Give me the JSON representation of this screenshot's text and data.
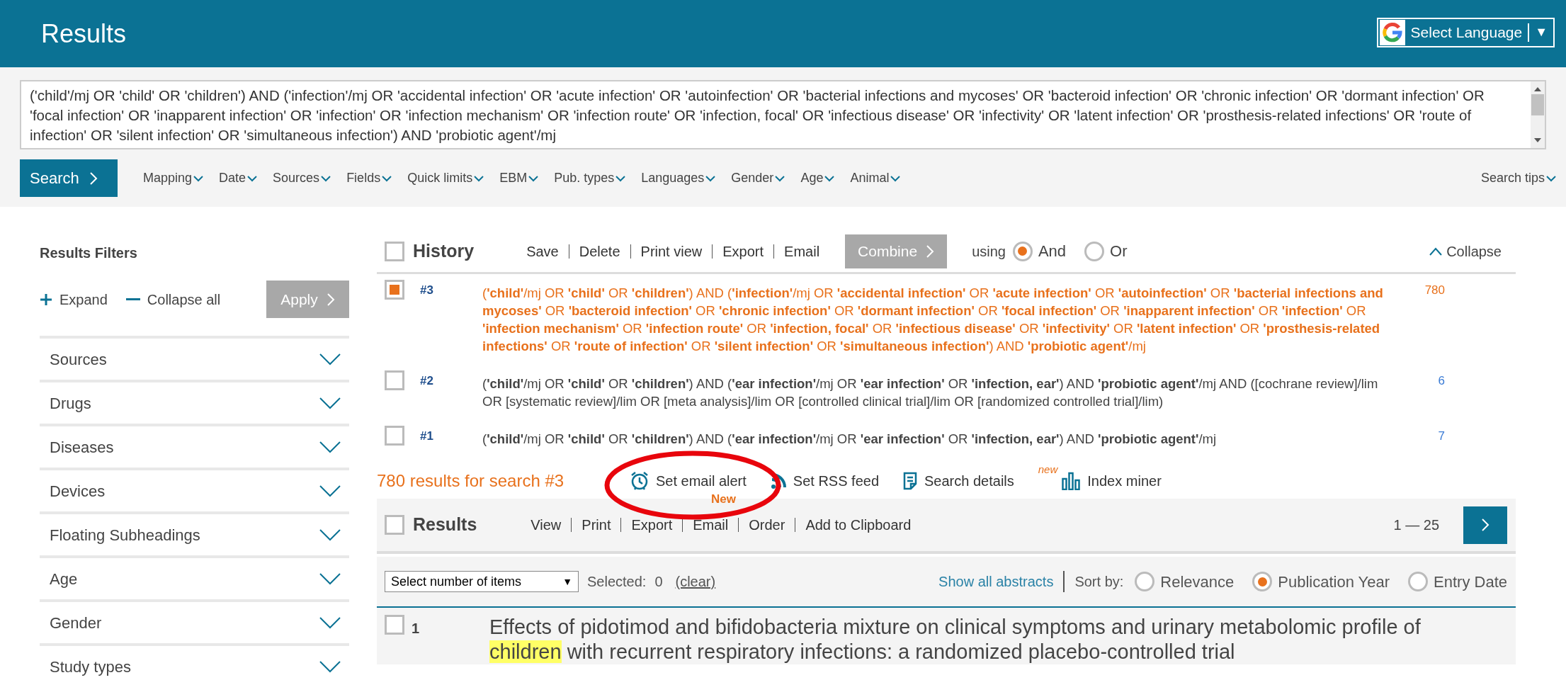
{
  "header": {
    "title": "Results",
    "language_button": {
      "label": "Select Language",
      "caret": "▼"
    }
  },
  "query": {
    "text": "('child'/mj OR 'child' OR 'children') AND ('infection'/mj OR 'accidental infection' OR 'acute infection' OR 'autoinfection' OR 'bacterial infections and mycoses' OR 'bacteroid infection' OR 'chronic infection' OR 'dormant infection' OR 'focal infection' OR 'inapparent infection' OR 'infection' OR 'infection mechanism' OR 'infection route' OR 'infection, focal' OR 'infectious disease' OR 'infectivity' OR 'latent infection' OR 'prosthesis-related infections' OR 'route of infection' OR 'silent infection' OR 'simultaneous infection') AND 'probiotic agent'/mj"
  },
  "search_button": "Search",
  "filter_menus": [
    "Mapping",
    "Date",
    "Sources",
    "Fields",
    "Quick limits",
    "EBM",
    "Pub. types",
    "Languages",
    "Gender",
    "Age",
    "Animal"
  ],
  "search_tips": "Search tips",
  "sidebar": {
    "title": "Results Filters",
    "expand": "Expand",
    "collapse_all": "Collapse all",
    "apply": "Apply",
    "filters": [
      "Sources",
      "Drugs",
      "Diseases",
      "Devices",
      "Floating Subheadings",
      "Age",
      "Gender",
      "Study types"
    ]
  },
  "history": {
    "title": "History",
    "checked": false,
    "actions": [
      "Save",
      "Delete",
      "Print view",
      "Export",
      "Email"
    ],
    "combine": "Combine",
    "using": "using",
    "options": [
      {
        "label": "And",
        "selected": true
      },
      {
        "label": "Or",
        "selected": false
      }
    ],
    "collapse": "Collapse",
    "rows": [
      {
        "number": "#3",
        "selected": true,
        "count": "780",
        "query": "(**'child'**/mj OR **'child'** OR **'children'**) AND (**'infection'**/mj OR **'accidental infection'** OR **'acute infection'** OR **'autoinfection'** OR **'bacterial infections and mycoses'** OR **'bacteroid infection'** OR **'chronic infection'** OR **'dormant infection'** OR **'focal infection'** OR **'inapparent infection'** OR **'infection'** OR **'infection mechanism'** OR **'infection route'** OR **'infection, focal'** OR **'infectious disease'** OR **'infectivity'** OR **'latent infection'** OR **'prosthesis-related infections'** OR **'route of infection'** OR **'silent infection'** OR **'simultaneous infection'**) AND **'probiotic agent'**/mj"
      },
      {
        "number": "#2",
        "selected": false,
        "count": "6",
        "query": "(**'child'**/mj OR **'child'** OR **'children'**) AND (**'ear infection'**/mj OR **'ear infection'** OR **'infection, ear'**) AND **'probiotic agent'**/mj AND ([cochrane review]/lim OR [systematic review]/lim OR [meta analysis]/lim OR [controlled clinical trial]/lim OR [randomized controlled trial]/lim)"
      },
      {
        "number": "#1",
        "selected": false,
        "count": "7",
        "query": "(**'child'**/mj OR **'child'** OR **'children'**) AND (**'ear infection'**/mj OR **'ear infection'** OR **'infection, ear'**) AND **'probiotic agent'**/mj"
      }
    ]
  },
  "results_summary": {
    "heading": "780 results for search #3",
    "links": [
      {
        "kind": "alarm",
        "label": "Set email alert"
      },
      {
        "kind": "rss",
        "label": "Set RSS feed"
      },
      {
        "kind": "details",
        "label": "Search details"
      },
      {
        "kind": "chart",
        "label": "Index miner",
        "badge": "new"
      }
    ],
    "new_label": "New"
  },
  "results_bar": {
    "title": "Results",
    "checked": false,
    "actions": [
      "View",
      "Print",
      "Export",
      "Email",
      "Order",
      "Add to Clipboard"
    ],
    "range": "1 — 25"
  },
  "sort_row": {
    "items_select": "Select number of items",
    "select_caret": "▼",
    "selected_label": "Selected:",
    "selected_count": "0",
    "clear": "(clear)",
    "show_all": "Show all abstracts",
    "sort_label": "Sort by:",
    "options": [
      {
        "label": "Relevance",
        "selected": false
      },
      {
        "label": "Publication Year",
        "selected": true
      },
      {
        "label": "Entry Date",
        "selected": false
      }
    ]
  },
  "items": [
    {
      "number": "1",
      "checked": false,
      "title_parts": [
        {
          "text": "Effects of pidotimod and bifidobacteria mixture on clinical symptoms and urinary metabolomic profile of",
          "highlighted": false
        },
        {
          "text": "children",
          "highlighted": true
        },
        {
          "text": "with recurrent respiratory infections: a randomized placebo-controlled trial",
          "highlighted": false
        }
      ]
    }
  ]
}
